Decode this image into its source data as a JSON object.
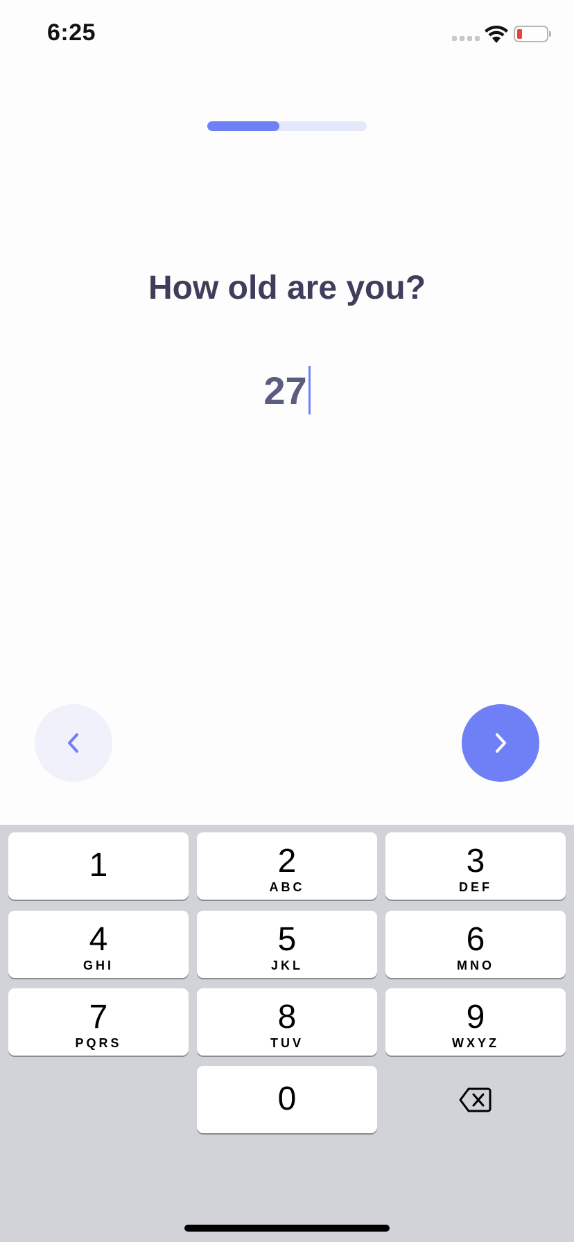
{
  "status_bar": {
    "time": "6:25"
  },
  "onboarding": {
    "progress": 0.45,
    "question": "How old are you?",
    "age_input": {
      "value": "27"
    }
  },
  "colors": {
    "accent": "#6f7ff6",
    "title": "#3f3d5c",
    "battery_low": "#e5443a",
    "keyboard_bg": "#d2d3d8"
  },
  "navigation": {
    "back_icon": "chevron-left-icon",
    "next_icon": "chevron-right-icon"
  },
  "keypad": {
    "keys": [
      {
        "digit": "1",
        "letters": ""
      },
      {
        "digit": "2",
        "letters": "ABC"
      },
      {
        "digit": "3",
        "letters": "DEF"
      },
      {
        "digit": "4",
        "letters": "GHI"
      },
      {
        "digit": "5",
        "letters": "JKL"
      },
      {
        "digit": "6",
        "letters": "MNO"
      },
      {
        "digit": "7",
        "letters": "PQRS"
      },
      {
        "digit": "8",
        "letters": "TUV"
      },
      {
        "digit": "9",
        "letters": "WXYZ"
      },
      {
        "digit": "0",
        "letters": ""
      }
    ],
    "delete_icon": "backspace-icon"
  }
}
